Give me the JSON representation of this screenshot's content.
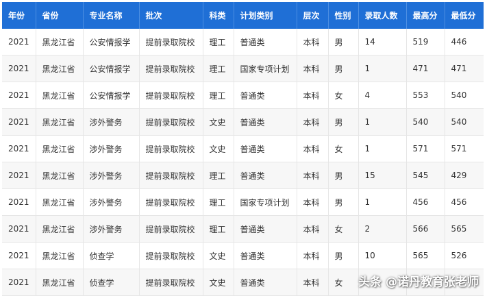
{
  "table": {
    "headers": [
      "年份",
      "省份",
      "专业名称",
      "批次",
      "科类",
      "计划类别",
      "层次",
      "性别",
      "录取人数",
      "最高分",
      "最低分"
    ],
    "rows": [
      [
        "2021",
        "黑龙江省",
        "公安情报学",
        "提前录取院校",
        "理工",
        "普通类",
        "本科",
        "男",
        "14",
        "519",
        "446"
      ],
      [
        "2021",
        "黑龙江省",
        "公安情报学",
        "提前录取院校",
        "理工",
        "国家专项计划",
        "本科",
        "男",
        "1",
        "471",
        "471"
      ],
      [
        "2021",
        "黑龙江省",
        "公安情报学",
        "提前录取院校",
        "理工",
        "普通类",
        "本科",
        "女",
        "4",
        "553",
        "540"
      ],
      [
        "2021",
        "黑龙江省",
        "涉外警务",
        "提前录取院校",
        "文史",
        "普通类",
        "本科",
        "男",
        "1",
        "540",
        "540"
      ],
      [
        "2021",
        "黑龙江省",
        "涉外警务",
        "提前录取院校",
        "文史",
        "普通类",
        "本科",
        "女",
        "1",
        "571",
        "571"
      ],
      [
        "2021",
        "黑龙江省",
        "涉外警务",
        "提前录取院校",
        "理工",
        "普通类",
        "本科",
        "男",
        "15",
        "545",
        "429"
      ],
      [
        "2021",
        "黑龙江省",
        "涉外警务",
        "提前录取院校",
        "理工",
        "国家专项计划",
        "本科",
        "男",
        "1",
        "456",
        "456"
      ],
      [
        "2021",
        "黑龙江省",
        "涉外警务",
        "提前录取院校",
        "理工",
        "普通类",
        "本科",
        "女",
        "2",
        "566",
        "565"
      ],
      [
        "2021",
        "黑龙江省",
        "侦查学",
        "提前录取院校",
        "文史",
        "普通类",
        "本科",
        "男",
        "10",
        "565",
        "526"
      ],
      [
        "2021",
        "黑龙江省",
        "侦查学",
        "提前录取院校",
        "文史",
        "普通类",
        "本科",
        "女",
        "",
        "",
        ""
      ]
    ]
  },
  "watermark": "头条 @诺丹教育张老师"
}
